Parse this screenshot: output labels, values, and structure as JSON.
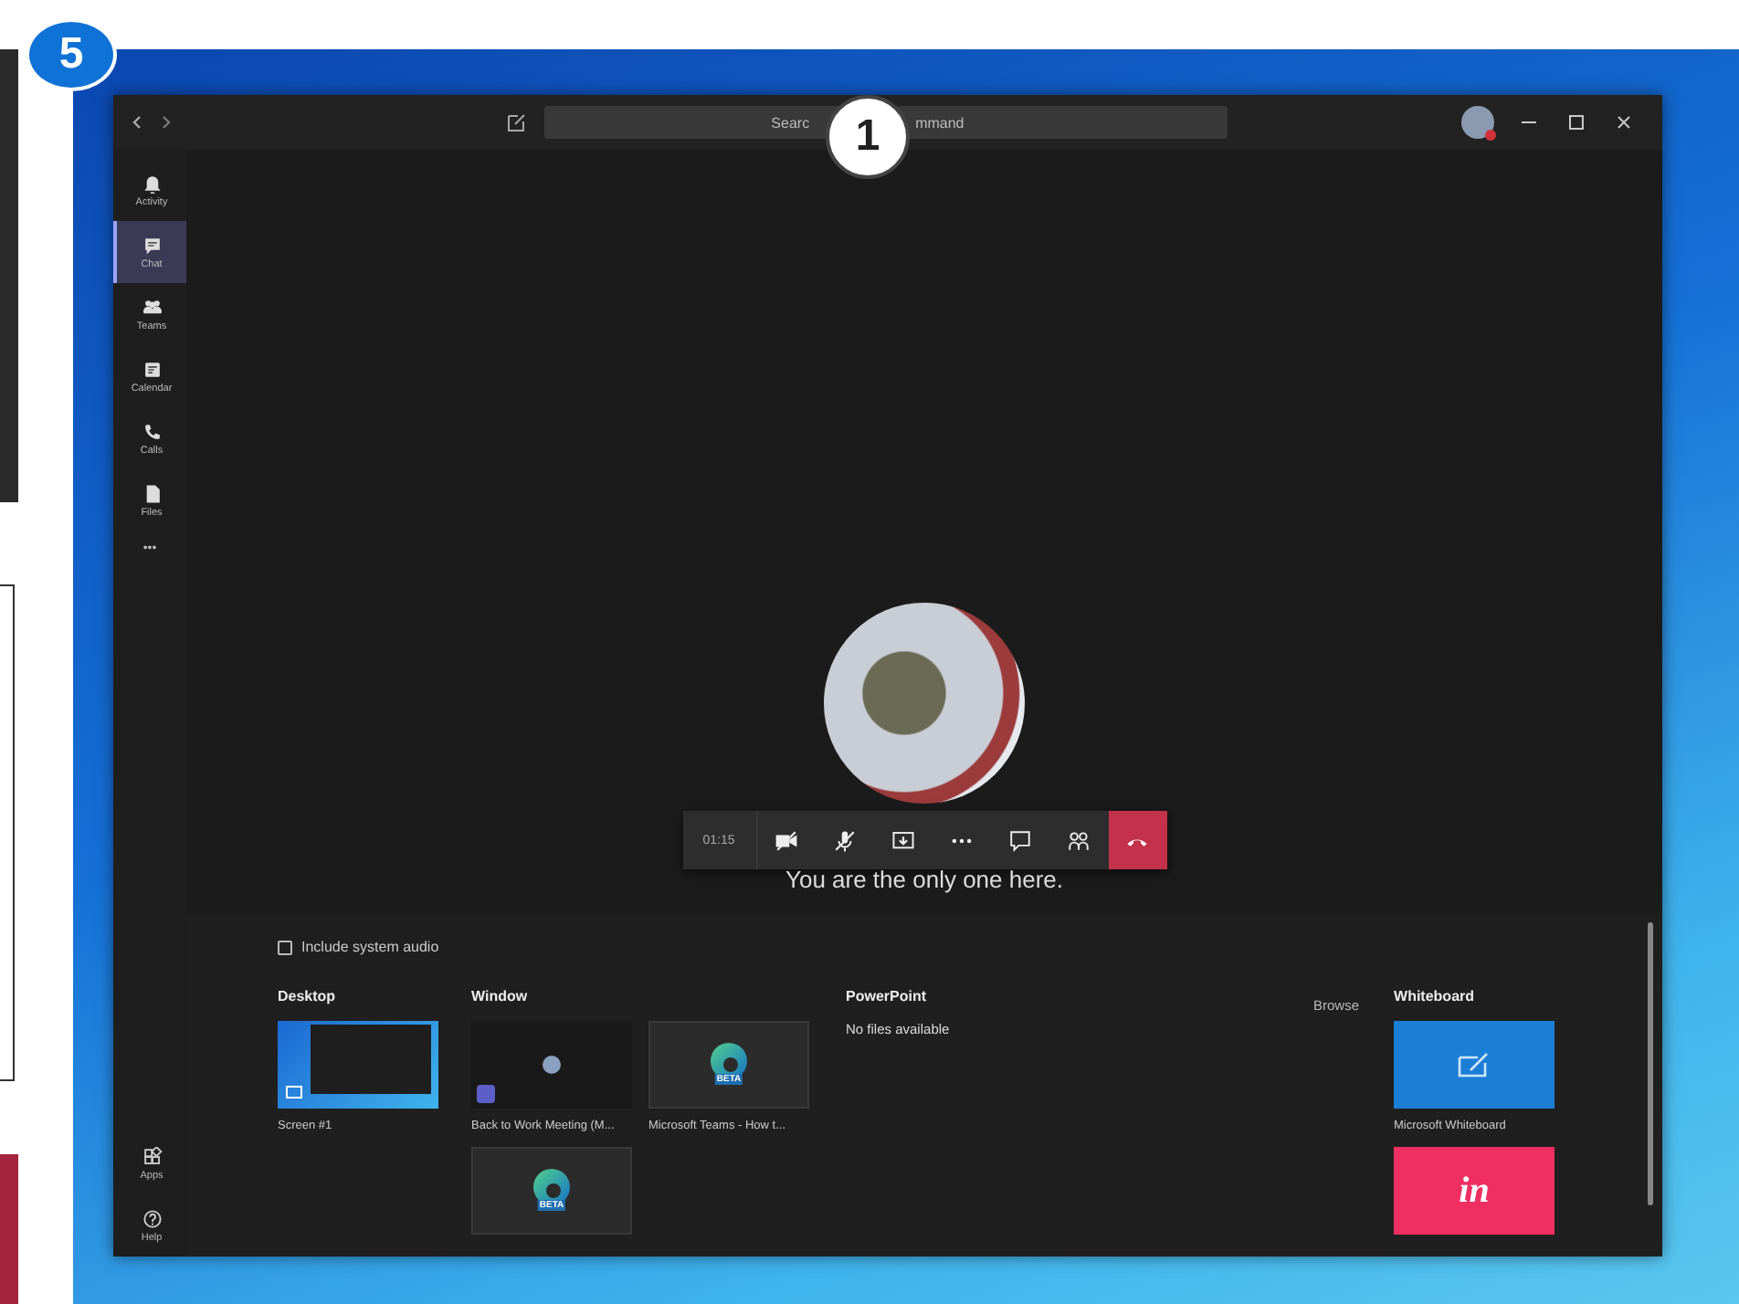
{
  "badges": {
    "corner": "5",
    "search": "1"
  },
  "search": {
    "text_before": "Searc",
    "text_after": "mmand"
  },
  "rail": {
    "items": [
      {
        "label": "Activity",
        "kind": "bell",
        "selected": false
      },
      {
        "label": "Chat",
        "kind": "chat",
        "selected": true
      },
      {
        "label": "Teams",
        "kind": "people",
        "selected": false
      },
      {
        "label": "Calendar",
        "kind": "calendar",
        "selected": false
      },
      {
        "label": "Calls",
        "kind": "phone",
        "selected": false
      },
      {
        "label": "Files",
        "kind": "file",
        "selected": false
      }
    ],
    "more": "•••",
    "bottom_items": [
      {
        "label": "Apps",
        "kind": "apps",
        "selected": false
      },
      {
        "label": "Help",
        "kind": "help",
        "selected": false
      }
    ]
  },
  "call": {
    "timer": "01:15",
    "controls": [
      {
        "kind": "camera",
        "off": true
      },
      {
        "kind": "mic",
        "off": true
      },
      {
        "kind": "share",
        "off": false
      },
      {
        "kind": "more",
        "off": false
      },
      {
        "kind": "chat",
        "off": false
      },
      {
        "kind": "people",
        "off": false
      },
      {
        "kind": "hangup",
        "off": false
      }
    ],
    "message": "You are the only one here."
  },
  "share_tray": {
    "include_audio": {
      "label": "Include system audio",
      "checked": false
    },
    "desktop": {
      "title": "Desktop",
      "items": [
        {
          "kind": "screen",
          "caption": "Screen #1"
        }
      ]
    },
    "window": {
      "title": "Window",
      "items": [
        {
          "kind": "meeting",
          "caption": "Back to Work Meeting (M..."
        },
        {
          "kind": "edge",
          "badge": "BETA",
          "caption": "Microsoft Teams - How t..."
        },
        {
          "kind": "edge",
          "badge": "BETA"
        }
      ]
    },
    "powerpoint": {
      "title": "PowerPoint",
      "message": "No files available",
      "browse": "Browse"
    },
    "whiteboard": {
      "title": "Whiteboard",
      "items": [
        {
          "kind": "whiteboard",
          "caption": "Microsoft Whiteboard"
        },
        {
          "kind": "invision",
          "logo_text": "in"
        }
      ]
    }
  }
}
